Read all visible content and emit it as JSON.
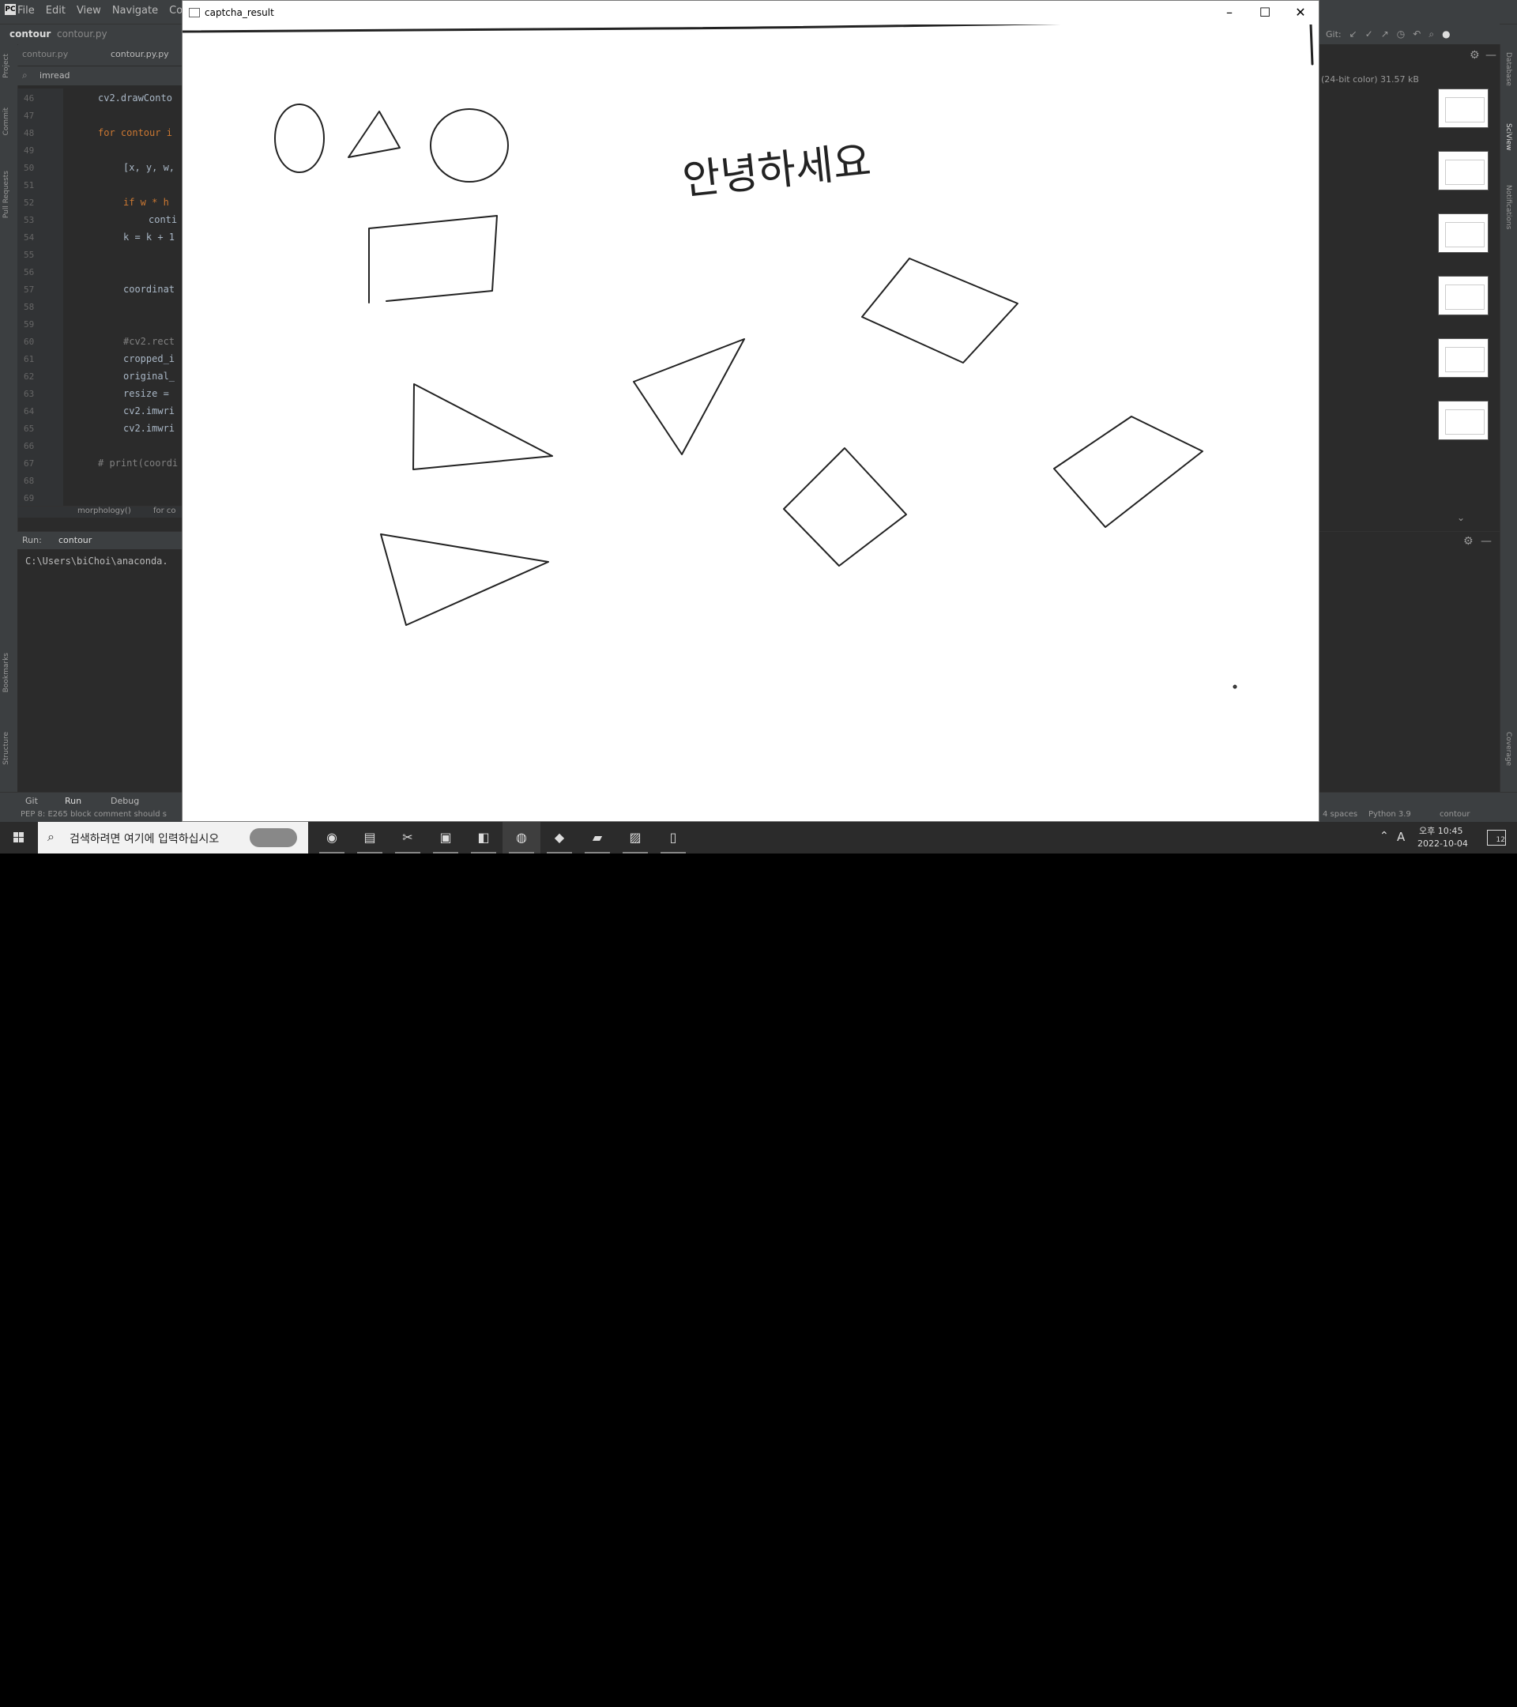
{
  "ide": {
    "menu": [
      "File",
      "Edit",
      "View",
      "Navigate",
      "Cod"
    ],
    "project_name": "contour",
    "nav_file": "contour.py",
    "tabs": [
      "contour.py",
      "contour.py.py"
    ],
    "search_value": "imread",
    "line_numbers": [
      "46",
      "47",
      "48",
      "49",
      "50",
      "51",
      "52",
      "53",
      "54",
      "55",
      "56",
      "57",
      "58",
      "59",
      "60",
      "61",
      "62",
      "63",
      "64",
      "65",
      "66",
      "67",
      "68",
      "69"
    ],
    "code_lines": [
      {
        "ln": 0,
        "text": "cv2.drawConto",
        "indent": 0
      },
      {
        "ln": 2,
        "text": "for contour i",
        "indent": 0
      },
      {
        "ln": 4,
        "text": "[x, y, w,",
        "indent": 1
      },
      {
        "ln": 6,
        "text": "if w * h",
        "indent": 1
      },
      {
        "ln": 7,
        "text": "conti",
        "indent": 2
      },
      {
        "ln": 8,
        "text": "k = k + 1",
        "indent": 1
      },
      {
        "ln": 11,
        "text": "coordinat",
        "indent": 1
      },
      {
        "ln": 14,
        "text": "#cv2.rect",
        "indent": 1
      },
      {
        "ln": 15,
        "text": "cropped_i",
        "indent": 1
      },
      {
        "ln": 16,
        "text": "original_",
        "indent": 1
      },
      {
        "ln": 17,
        "text": "resize =",
        "indent": 1
      },
      {
        "ln": 18,
        "text": "cv2.imwri",
        "indent": 1
      },
      {
        "ln": 19,
        "text": "cv2.imwri",
        "indent": 1
      },
      {
        "ln": 21,
        "text": "# print(coordi",
        "indent": 0
      }
    ],
    "breadcrumb": [
      "morphology()",
      "for co"
    ],
    "run_label": "Run:",
    "run_tab": "contour",
    "run_output": "C:\\Users\\biChoi\\anaconda.",
    "bottom_tools": [
      "Git",
      "Run",
      "Debug"
    ],
    "status_left": "PEP 8: E265 block comment should s",
    "status_right": [
      "4 spaces",
      "Python 3.9",
      "contour"
    ],
    "right_info": "(24-bit color) 31.57 kB",
    "right_git_label": "Git:",
    "left_strip_labels": [
      "Project",
      "Commit",
      "Pull Requests",
      "Bookmarks",
      "Structure"
    ],
    "right_strip_labels": [
      "Database",
      "SciView",
      "Notifications",
      "Coverage"
    ]
  },
  "window": {
    "title": "captcha_result",
    "minimize": "–",
    "maximize": "☐",
    "close": "✕",
    "handwriting": "안녕하세요"
  },
  "taskbar": {
    "search_placeholder": "검색하려면 여기에 입력하십시오",
    "tray_time_prefix": "오후 10:45",
    "tray_date": "2022-10-04",
    "tray_lang": "A",
    "notif_count": "12"
  },
  "colors": {
    "ide_bg": "#2b2b2b",
    "ide_panel": "#3c3f41",
    "window_bg": "#ffffff",
    "ink": "#222222"
  }
}
